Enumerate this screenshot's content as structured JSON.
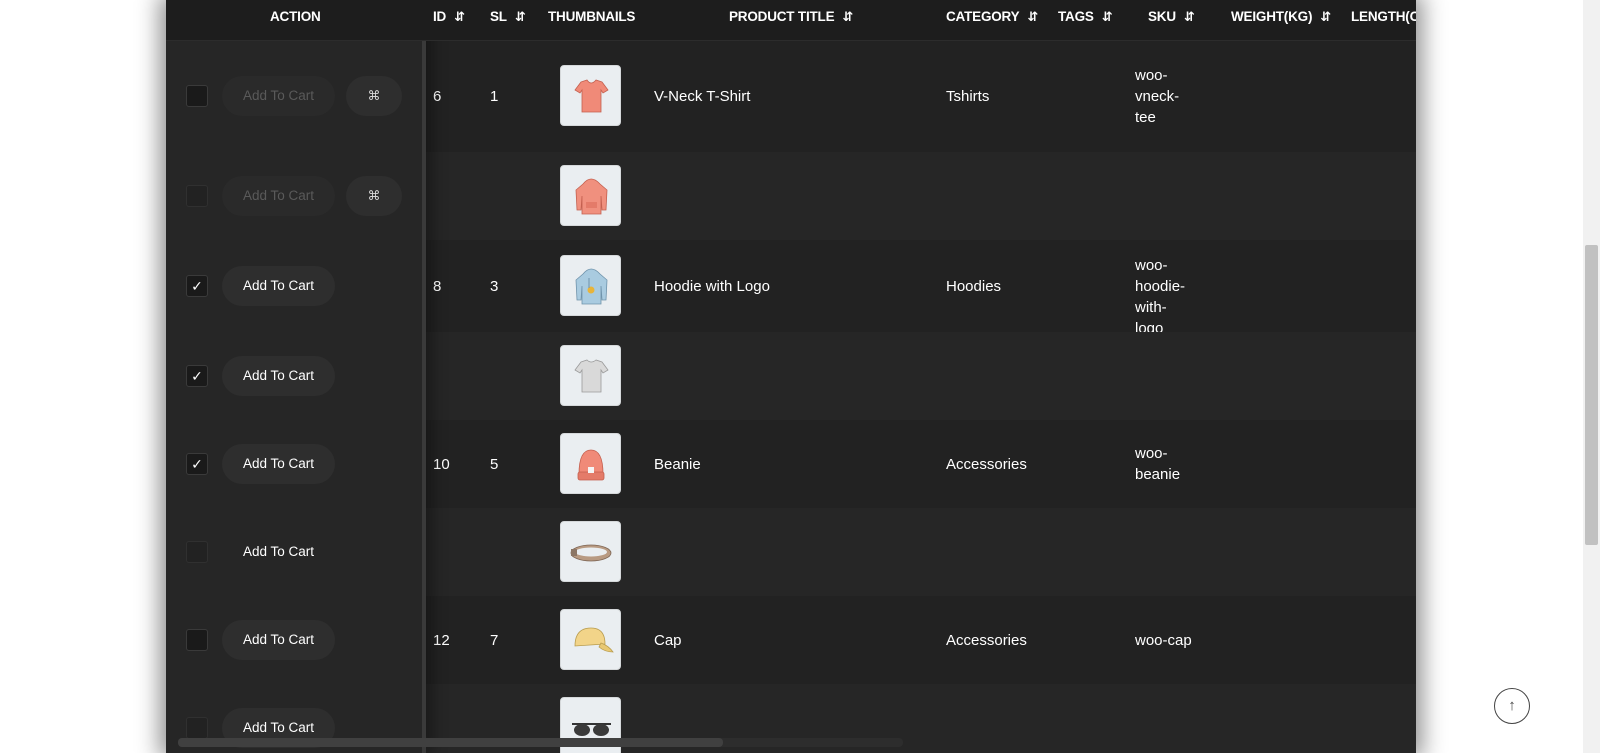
{
  "headers": {
    "action": "ACTION",
    "id": "ID",
    "sl": "SL",
    "thumbnails": "THUMBNAILS",
    "product_title": "PRODUCT TITLE",
    "category": "CATEGORY",
    "tags": "TAGS",
    "sku": "SKU",
    "weight": "WEIGHT(KG)",
    "length": "LENGTH(C"
  },
  "sort_icon": "⇵",
  "add_to_cart_label": "Add To Cart",
  "quick_view_icon": "⌘",
  "check_mark": "✓",
  "back_to_top_icon": "↑",
  "rows": [
    {
      "id": "6",
      "sl": "1",
      "title": "V-Neck T-Shirt",
      "category": "Tshirts",
      "sku": "woo-vneck-tee",
      "checked": false,
      "thumb": "vneck-tshirt"
    },
    {
      "id": "",
      "sl": "",
      "title": "",
      "category": "",
      "sku": "",
      "checked": false,
      "thumb": "hoodie"
    },
    {
      "id": "8",
      "sl": "3",
      "title": "Hoodie with Logo",
      "category": "Hoodies",
      "sku": "woo-hoodie-with-logo",
      "checked": true,
      "thumb": "hoodie-with-logo"
    },
    {
      "id": "",
      "sl": "",
      "title": "",
      "category": "",
      "sku": "",
      "checked": true,
      "thumb": "tshirt"
    },
    {
      "id": "10",
      "sl": "5",
      "title": "Beanie",
      "category": "Accessories",
      "sku": "woo-beanie",
      "checked": true,
      "thumb": "beanie"
    },
    {
      "id": "",
      "sl": "",
      "title": "",
      "category": "",
      "sku": "",
      "checked": false,
      "thumb": "belt"
    },
    {
      "id": "12",
      "sl": "7",
      "title": "Cap",
      "category": "Accessories",
      "sku": "woo-cap",
      "checked": false,
      "thumb": "cap"
    },
    {
      "id": "",
      "sl": "",
      "title": "",
      "category": "",
      "sku": "",
      "checked": false,
      "thumb": "sunglasses"
    }
  ],
  "colors": {
    "table_bg": "#222222",
    "row_alt_bg": "#262626",
    "header_bg": "#1d1d1d",
    "text": "#ffffff",
    "thumb_bg": "#eaeef1",
    "shirt_coral": "#f08a78",
    "hoodie_blue": "#a9cbe0",
    "cap_yellow": "#f2d489"
  }
}
